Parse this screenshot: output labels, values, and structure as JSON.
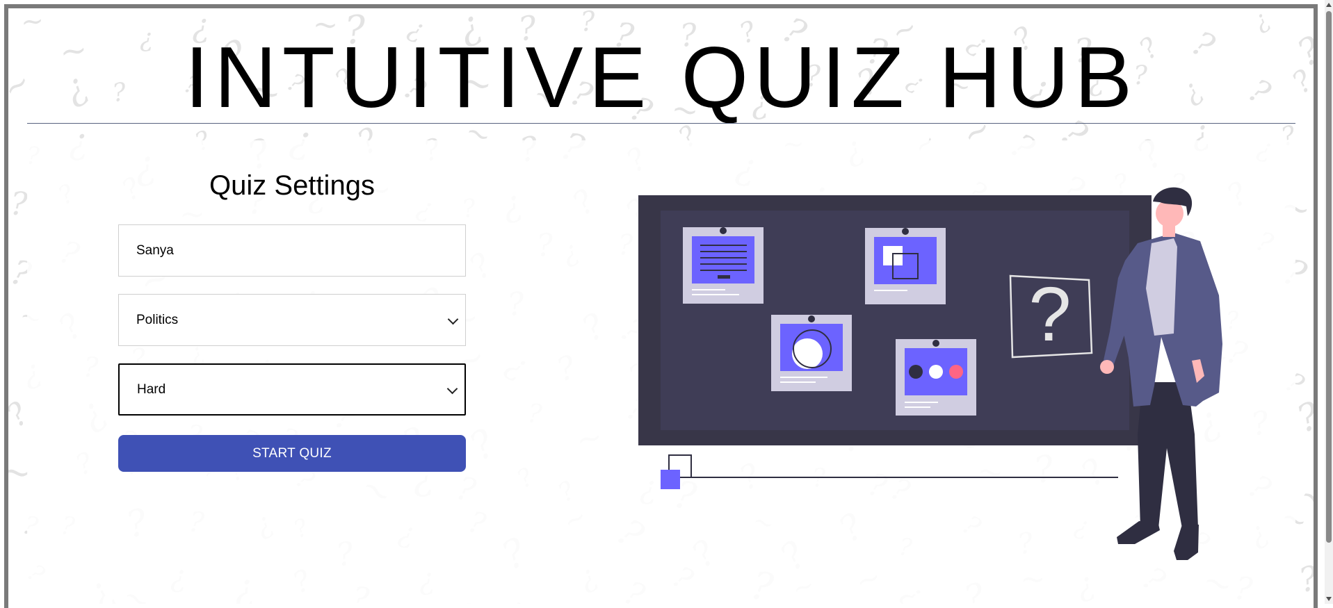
{
  "app": {
    "title": "INTUITIVE QUIZ HUB"
  },
  "settings": {
    "heading": "Quiz Settings",
    "name_value": "Sanya",
    "category_selected": "Politics",
    "difficulty_selected": "Hard",
    "start_label": "START QUIZ"
  },
  "illustration": {
    "question_mark": "?"
  },
  "colors": {
    "accent": "#3f51b5",
    "board": "#3f3d56",
    "card_fill": "#6c63ff",
    "card_paper": "#d0cde1",
    "coat": "#575a89",
    "skin": "#ffb8b8",
    "hair": "#2f2e41",
    "dot_red": "#ff6584"
  }
}
